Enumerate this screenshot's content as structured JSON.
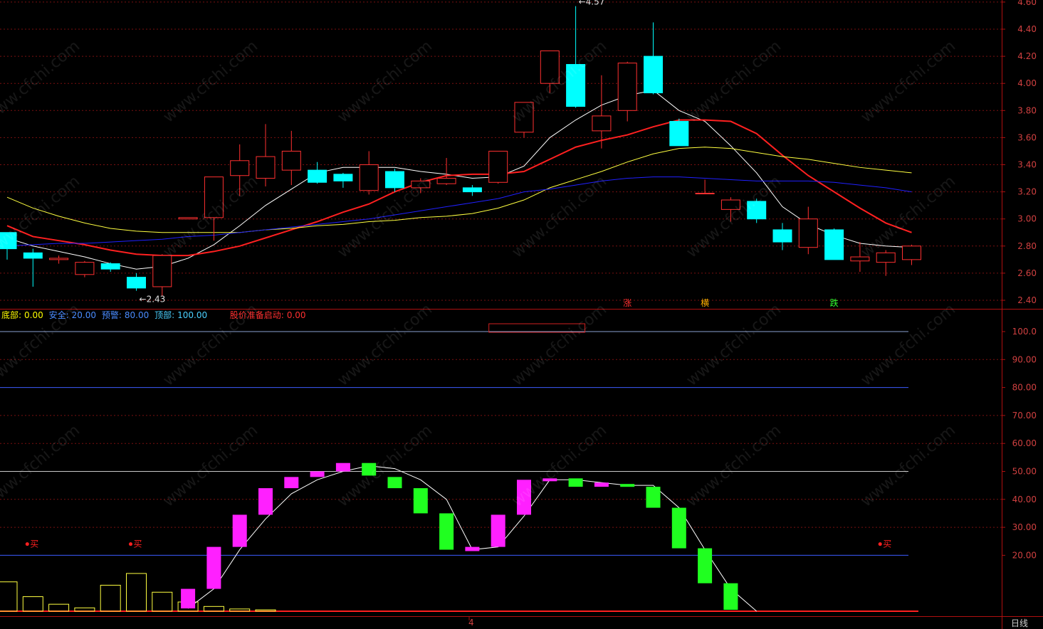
{
  "chart_data": [
    {
      "type": "candlestick",
      "y_axis": {
        "ticks": [
          "2.40",
          "2.60",
          "2.80",
          "3.00",
          "3.20",
          "3.40",
          "3.60",
          "3.80",
          "4.00",
          "4.20",
          "4.40",
          "4.60"
        ],
        "ylim": [
          2.35,
          4.62
        ]
      },
      "candles": [
        {
          "o": 2.78,
          "h": 2.84,
          "l": 2.7,
          "c": 2.9,
          "d": "down"
        },
        {
          "o": 2.75,
          "h": 2.78,
          "l": 2.5,
          "c": 2.71
        },
        {
          "o": 2.7,
          "h": 2.73,
          "l": 2.67,
          "c": 2.71
        },
        {
          "o": 2.59,
          "h": 2.69,
          "l": 2.57,
          "c": 2.68
        },
        {
          "o": 2.67,
          "h": 2.68,
          "l": 2.61,
          "c": 2.63
        },
        {
          "o": 2.57,
          "h": 2.6,
          "l": 2.47,
          "c": 2.49
        },
        {
          "o": 2.5,
          "h": 2.74,
          "l": 2.43,
          "c": 2.73
        },
        {
          "o": 3.0,
          "h": 3.0,
          "l": 3.0,
          "c": 3.01
        },
        {
          "o": 3.01,
          "h": 3.31,
          "l": 2.84,
          "c": 3.31
        },
        {
          "o": 3.32,
          "h": 3.55,
          "l": 3.17,
          "c": 3.43
        },
        {
          "o": 3.3,
          "h": 3.7,
          "l": 3.24,
          "c": 3.46
        },
        {
          "o": 3.36,
          "h": 3.65,
          "l": 3.25,
          "c": 3.5
        },
        {
          "o": 3.36,
          "h": 3.42,
          "l": 3.26,
          "c": 3.27
        },
        {
          "o": 3.33,
          "h": 3.34,
          "l": 3.23,
          "c": 3.28
        },
        {
          "o": 3.21,
          "h": 3.5,
          "l": 3.18,
          "c": 3.4
        },
        {
          "o": 3.35,
          "h": 3.37,
          "l": 3.2,
          "c": 3.23
        },
        {
          "o": 3.23,
          "h": 3.3,
          "l": 3.19,
          "c": 3.28
        },
        {
          "o": 3.26,
          "h": 3.45,
          "l": 3.25,
          "c": 3.3
        },
        {
          "o": 3.23,
          "h": 3.25,
          "l": 3.17,
          "c": 3.2
        },
        {
          "o": 3.27,
          "h": 3.5,
          "l": 3.26,
          "c": 3.5
        },
        {
          "o": 3.64,
          "h": 3.86,
          "l": 3.6,
          "c": 3.86
        },
        {
          "o": 4.0,
          "h": 4.24,
          "l": 3.93,
          "c": 4.24
        },
        {
          "o": 4.14,
          "h": 4.57,
          "l": 3.82,
          "c": 3.83
        },
        {
          "o": 3.65,
          "h": 4.06,
          "l": 3.52,
          "c": 3.76
        },
        {
          "o": 3.8,
          "h": 4.16,
          "l": 3.72,
          "c": 4.15
        },
        {
          "o": 4.2,
          "h": 4.45,
          "l": 3.92,
          "c": 3.93
        },
        {
          "o": 3.72,
          "h": 3.74,
          "l": 3.54,
          "c": 3.54
        },
        {
          "o": 3.19,
          "h": 3.29,
          "l": 3.19,
          "c": 3.19
        },
        {
          "o": 3.07,
          "h": 3.16,
          "l": 2.98,
          "c": 3.14
        },
        {
          "o": 3.13,
          "h": 3.15,
          "l": 2.97,
          "c": 3.0
        },
        {
          "o": 2.92,
          "h": 2.97,
          "l": 2.77,
          "c": 2.83
        },
        {
          "o": 2.79,
          "h": 3.09,
          "l": 2.74,
          "c": 3.0
        },
        {
          "o": 2.92,
          "h": 2.93,
          "l": 2.7,
          "c": 2.7
        },
        {
          "o": 2.69,
          "h": 2.83,
          "l": 2.61,
          "c": 2.72
        },
        {
          "o": 2.68,
          "h": 2.77,
          "l": 2.58,
          "c": 2.75
        },
        {
          "o": 2.7,
          "h": 2.81,
          "l": 2.66,
          "c": 2.8
        }
      ],
      "moving_averages": [
        {
          "color": "#ffffff",
          "values": [
            2.86,
            2.8,
            2.76,
            2.72,
            2.67,
            2.63,
            2.65,
            2.71,
            2.81,
            2.95,
            3.1,
            3.22,
            3.34,
            3.38,
            3.38,
            3.38,
            3.35,
            3.33,
            3.3,
            3.31,
            3.39,
            3.6,
            3.73,
            3.84,
            3.91,
            3.95,
            3.8,
            3.72,
            3.54,
            3.34,
            3.09,
            2.96,
            2.88,
            2.82,
            2.8,
            2.79
          ]
        },
        {
          "color": "#ff2020",
          "values": [
            2.95,
            2.87,
            2.84,
            2.81,
            2.77,
            2.74,
            2.73,
            2.73,
            2.76,
            2.8,
            2.86,
            2.92,
            2.98,
            3.05,
            3.11,
            3.2,
            3.27,
            3.32,
            3.33,
            3.33,
            3.35,
            3.44,
            3.53,
            3.58,
            3.62,
            3.68,
            3.73,
            3.73,
            3.72,
            3.63,
            3.47,
            3.32,
            3.2,
            3.08,
            2.97,
            2.9
          ]
        },
        {
          "color": "#ffff40",
          "values": [
            3.16,
            3.08,
            3.02,
            2.97,
            2.93,
            2.91,
            2.9,
            2.9,
            2.9,
            2.9,
            2.92,
            2.93,
            2.95,
            2.96,
            2.98,
            2.99,
            3.01,
            3.02,
            3.04,
            3.08,
            3.14,
            3.23,
            3.29,
            3.35,
            3.42,
            3.48,
            3.52,
            3.53,
            3.52,
            3.49,
            3.46,
            3.44,
            3.41,
            3.38,
            3.36,
            3.34
          ]
        },
        {
          "color": "#2020ff",
          "values": [
            2.8,
            2.81,
            2.82,
            2.82,
            2.83,
            2.84,
            2.85,
            2.87,
            2.88,
            2.9,
            2.92,
            2.94,
            2.96,
            2.98,
            3.0,
            3.03,
            3.06,
            3.09,
            3.12,
            3.15,
            3.2,
            3.22,
            3.25,
            3.28,
            3.3,
            3.31,
            3.31,
            3.3,
            3.29,
            3.28,
            3.28,
            3.28,
            3.27,
            3.25,
            3.23,
            3.2
          ]
        }
      ],
      "annotations": [
        {
          "index": 5,
          "text": "2.43",
          "price": 2.43,
          "pos": "below"
        },
        {
          "index": 22,
          "text": "4.57",
          "price": 4.57,
          "pos": "above"
        }
      ],
      "signals": [
        {
          "index": 24,
          "text": "涨",
          "color": "#ff3030"
        },
        {
          "index": 27,
          "text": "横",
          "color": "#ffb000"
        },
        {
          "index": 32,
          "text": "跌",
          "color": "#30ff30"
        }
      ]
    },
    {
      "type": "indicator",
      "legend": [
        {
          "label": "底部:",
          "value": "0.00",
          "color": "#ffff00"
        },
        {
          "label": "安全:",
          "value": "20.00",
          "color": "#4a8cff"
        },
        {
          "label": "预警:",
          "value": "80.00",
          "color": "#4a8cff"
        },
        {
          "label": "顶部:",
          "value": "100.00",
          "color": "#4ad0ff"
        },
        {
          "label": "股价准备启动:",
          "value": "0.00",
          "color": "#ff3030"
        }
      ],
      "y_axis": {
        "ticks": [
          "20.00",
          "30.00",
          "40.00",
          "50.00",
          "60.00",
          "70.00",
          "80.00",
          "90.00",
          "100.0"
        ],
        "ylim": [
          0,
          105
        ]
      },
      "ref_lines": [
        {
          "value": 100,
          "color": "#8aa0d0"
        },
        {
          "value": 80,
          "color": "#3c5cff"
        },
        {
          "value": 50,
          "color": "#c8c8c8"
        },
        {
          "value": 20,
          "color": "#3c5cff"
        },
        {
          "value": 0,
          "color": "#ff2020"
        }
      ],
      "line": [
        null,
        null,
        null,
        null,
        null,
        null,
        null,
        1,
        8,
        22,
        33,
        42,
        47,
        50,
        52,
        51,
        47,
        40,
        22,
        23,
        34,
        47,
        47,
        46,
        45,
        45,
        37,
        22,
        8,
        0,
        null,
        null,
        null,
        null,
        null,
        null
      ],
      "bars": [
        {
          "index": 7,
          "o": 1,
          "c": 8,
          "color": "#ff20ff"
        },
        {
          "index": 8,
          "o": 8,
          "c": 23,
          "color": "#ff20ff"
        },
        {
          "index": 9,
          "o": 23,
          "c": 34.5,
          "color": "#ff20ff"
        },
        {
          "index": 10,
          "o": 34.5,
          "c": 44,
          "color": "#ff20ff"
        },
        {
          "index": 11,
          "o": 44,
          "c": 48,
          "color": "#ff20ff"
        },
        {
          "index": 12,
          "o": 48,
          "c": 50,
          "color": "#ff20ff"
        },
        {
          "index": 13,
          "o": 50,
          "c": 53,
          "color": "#ff20ff"
        },
        {
          "index": 14,
          "o": 53,
          "c": 48.5,
          "color": "#20ff20"
        },
        {
          "index": 15,
          "o": 48,
          "c": 44,
          "color": "#20ff20"
        },
        {
          "index": 16,
          "o": 44,
          "c": 35,
          "color": "#20ff20"
        },
        {
          "index": 17,
          "o": 35,
          "c": 22,
          "color": "#20ff20"
        },
        {
          "index": 18,
          "o": 21.5,
          "c": 23,
          "color": "#ff20ff"
        },
        {
          "index": 19,
          "o": 23,
          "c": 34.5,
          "color": "#ff20ff"
        },
        {
          "index": 20,
          "o": 34.5,
          "c": 47,
          "color": "#ff20ff"
        },
        {
          "index": 21,
          "o": 47,
          "c": 47.5,
          "color": "#ff20ff"
        },
        {
          "index": 22,
          "o": 47.5,
          "c": 44.5,
          "color": "#20ff20"
        },
        {
          "index": 23,
          "o": 44.5,
          "c": 46,
          "color": "#ff20ff"
        },
        {
          "index": 24,
          "o": 45.5,
          "c": 44.5,
          "color": "#20ff20"
        },
        {
          "index": 25,
          "o": 44.5,
          "c": 37,
          "color": "#20ff20"
        },
        {
          "index": 26,
          "o": 37,
          "c": 22.5,
          "color": "#20ff20"
        },
        {
          "index": 27,
          "o": 22.5,
          "c": 10,
          "color": "#20ff20"
        },
        {
          "index": 28,
          "o": 10,
          "c": 0.5,
          "color": "#20ff20"
        }
      ],
      "volume_boxes": [
        {
          "index": 0,
          "value": 10.5
        },
        {
          "index": 1,
          "value": 5.2
        },
        {
          "index": 2,
          "value": 2.5
        },
        {
          "index": 3,
          "value": 1.2
        },
        {
          "index": 4,
          "value": 9.3
        },
        {
          "index": 5,
          "value": 13.5
        },
        {
          "index": 6,
          "value": 6.8
        },
        {
          "index": 7,
          "value": 3.3
        },
        {
          "index": 8,
          "value": 1.7
        },
        {
          "index": 9,
          "value": 0.8
        },
        {
          "index": 10,
          "value": 0.5
        }
      ],
      "buy_markers": [
        {
          "index": 1,
          "text": "买",
          "level": 24
        },
        {
          "index": 5,
          "text": "买",
          "level": 24
        },
        {
          "index": 34,
          "text": "买",
          "level": 24
        }
      ],
      "overflow_box": {
        "from": 19,
        "to": 22
      }
    }
  ],
  "footer": {
    "x_label": "4",
    "period": "日线"
  },
  "watermark": "www.cfchi.com"
}
